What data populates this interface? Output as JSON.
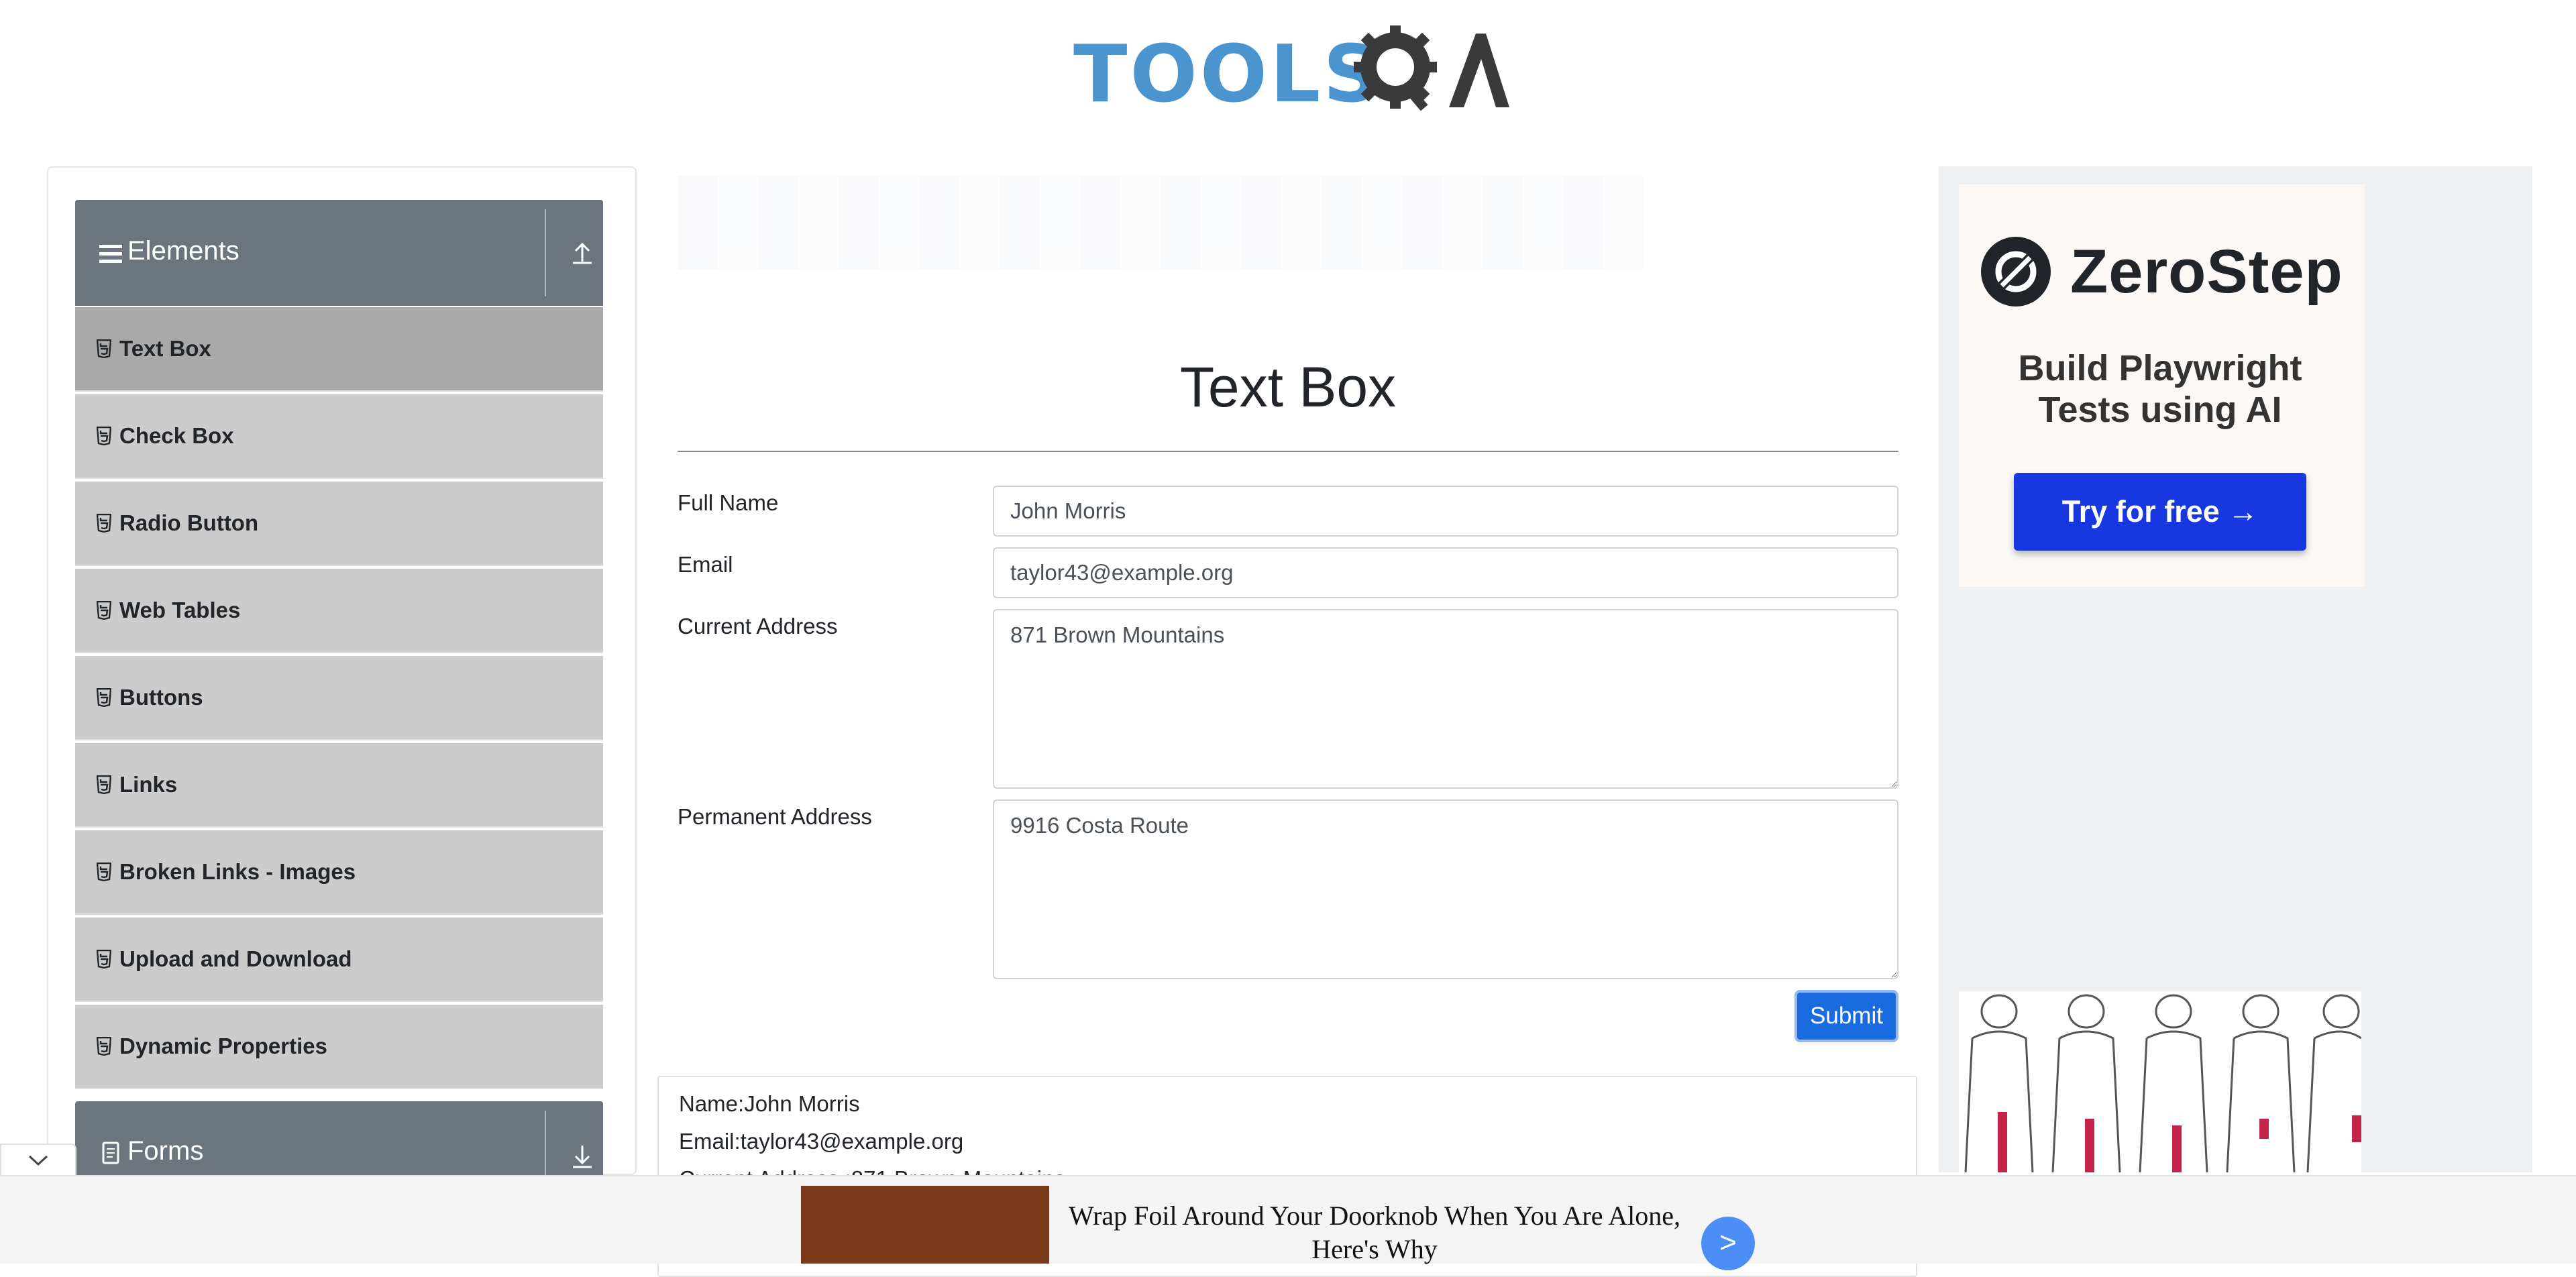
{
  "header": {
    "logo_text": "TOOLS",
    "logo_qa": "QA"
  },
  "sidebar": {
    "groups": [
      {
        "label": "Elements",
        "expanded": true
      },
      {
        "label": "Forms",
        "expanded": false
      }
    ],
    "items": [
      {
        "label": "Text Box",
        "active": true
      },
      {
        "label": "Check Box"
      },
      {
        "label": "Radio Button"
      },
      {
        "label": "Web Tables"
      },
      {
        "label": "Buttons"
      },
      {
        "label": "Links"
      },
      {
        "label": "Broken Links - Images"
      },
      {
        "label": "Upload and Download"
      },
      {
        "label": "Dynamic Properties"
      }
    ]
  },
  "main": {
    "title": "Text Box",
    "form": {
      "full_name_label": "Full Name",
      "full_name_value": "John Morris",
      "email_label": "Email",
      "email_value": "taylor43@example.org",
      "current_address_label": "Current Address",
      "current_address_value": "871 Brown Mountains",
      "permanent_address_label": "Permanent Address",
      "permanent_address_value": "9916 Costa Route",
      "submit_label": "Submit"
    },
    "output": {
      "name": "Name:John Morris",
      "email": "Email:taylor43@example.org",
      "current_address": "Current Address :871 Brown Mountains"
    }
  },
  "right_ad": {
    "brand": "ZeroStep",
    "tagline": "Build Playwright Tests using AI",
    "cta": "Try for free →"
  },
  "bottom_ad": {
    "headline": "Wrap Foil Around Your Doorknob When You Are Alone, Here's Why",
    "go": ">"
  },
  "colors": {
    "sidebar_header": "#6c757d",
    "menu_item": "#cccccc",
    "menu_item_active": "#a9a9a9",
    "submit": "#1a6be0",
    "zerostep_button": "#1738e0"
  }
}
